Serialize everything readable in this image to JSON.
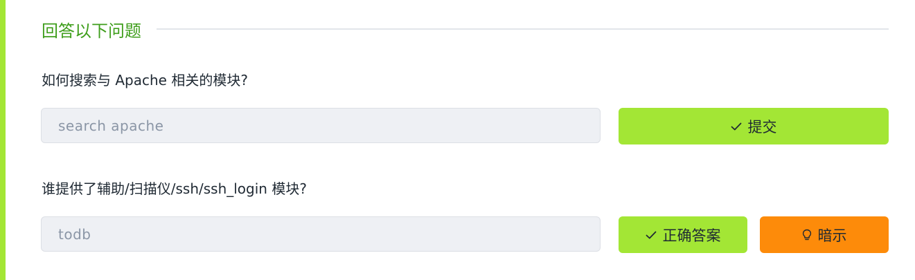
{
  "section": {
    "title": "回答以下问题"
  },
  "questions": [
    {
      "text": "如何搜索与 Apache 相关的模块?",
      "answer_value": "search apache",
      "button_label": "提交"
    },
    {
      "text": "谁提供了辅助/扫描仪/ssh/ssh_login 模块?",
      "answer_value": "todb",
      "correct_label": "正确答案",
      "hint_label": "暗示"
    }
  ],
  "icons": {
    "submit": "check-icon",
    "correct": "check-icon",
    "hint": "lightbulb-icon"
  },
  "colors": {
    "accent": "#a3e635",
    "title": "#3f9e1c",
    "hint": "#fd8b0a",
    "field_bg": "#eef0f4"
  }
}
